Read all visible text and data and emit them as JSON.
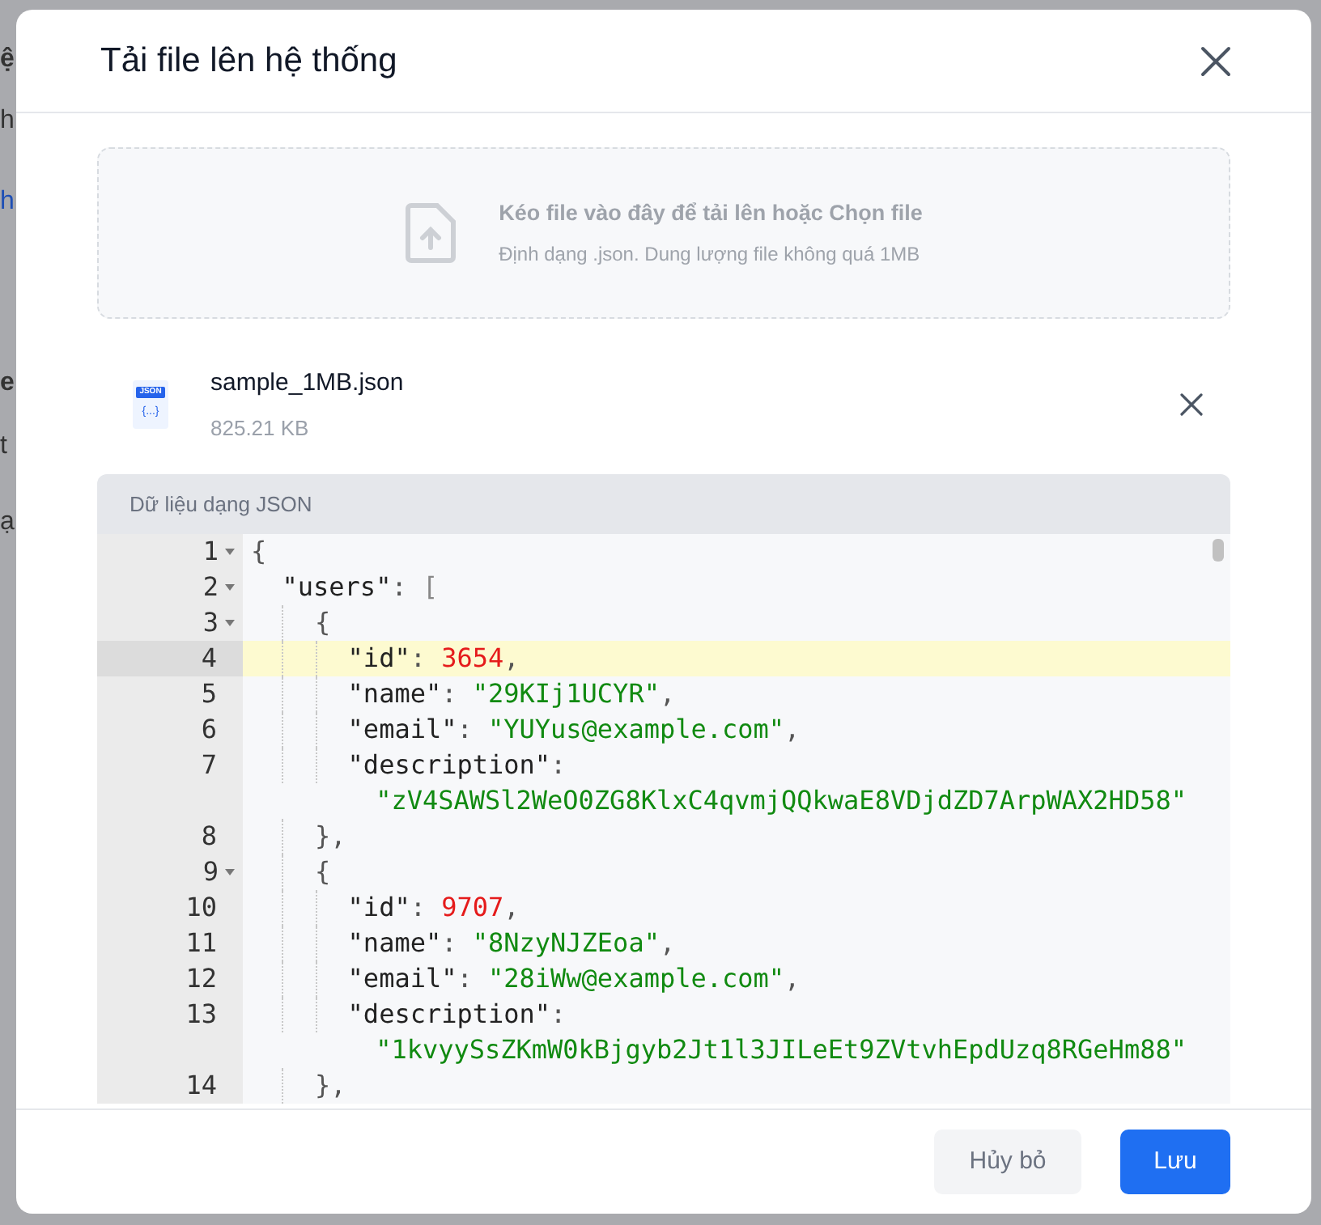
{
  "background": {
    "fragments": [
      {
        "text": "ệ",
        "kind": "heading"
      },
      {
        "text": "h",
        "kind": "text"
      },
      {
        "text": "h",
        "kind": "link"
      },
      {
        "text": "e",
        "kind": "heading"
      },
      {
        "text": "t",
        "kind": "text"
      },
      {
        "text": "ạ",
        "kind": "text"
      }
    ]
  },
  "dialog": {
    "title": "Tải file lên hệ thống",
    "dropzone": {
      "text": "Kéo file vào đây để tải lên hoặc Chọn file",
      "hint": "Định dạng .json. Dung lượng file không quá 1MB"
    },
    "file": {
      "icon_label": "JSON",
      "icon_glyph": "{...}",
      "name": "sample_1MB.json",
      "size": "825.21 KB"
    },
    "editor": {
      "header": "Dữ liệu dạng JSON",
      "lines": [
        {
          "number": "1",
          "foldable": true,
          "active": false,
          "rows": [
            [
              {
                "kind": "punct",
                "text": "{"
              }
            ]
          ]
        },
        {
          "number": "2",
          "foldable": true,
          "active": false,
          "rows": [
            [
              {
                "kind": "indent",
                "text": "  "
              },
              {
                "kind": "key",
                "text": "\"users\""
              },
              {
                "kind": "punct",
                "text": ": "
              },
              {
                "kind": "bracket",
                "text": "["
              }
            ]
          ]
        },
        {
          "number": "3",
          "foldable": true,
          "active": false,
          "rows": [
            [
              {
                "kind": "indent",
                "text": "    "
              },
              {
                "kind": "punct",
                "text": "{"
              }
            ]
          ]
        },
        {
          "number": "4",
          "foldable": false,
          "active": true,
          "rows": [
            [
              {
                "kind": "indent",
                "text": "      "
              },
              {
                "kind": "key",
                "text": "\"id\""
              },
              {
                "kind": "punct",
                "text": ": "
              },
              {
                "kind": "number",
                "text": "3654"
              },
              {
                "kind": "punct",
                "text": ","
              }
            ]
          ]
        },
        {
          "number": "5",
          "foldable": false,
          "active": false,
          "rows": [
            [
              {
                "kind": "indent",
                "text": "      "
              },
              {
                "kind": "key",
                "text": "\"name\""
              },
              {
                "kind": "punct",
                "text": ": "
              },
              {
                "kind": "string",
                "text": "\"29KIj1UCYR\""
              },
              {
                "kind": "punct",
                "text": ","
              }
            ]
          ]
        },
        {
          "number": "6",
          "foldable": false,
          "active": false,
          "rows": [
            [
              {
                "kind": "indent",
                "text": "      "
              },
              {
                "kind": "key",
                "text": "\"email\""
              },
              {
                "kind": "punct",
                "text": ": "
              },
              {
                "kind": "string",
                "text": "\"YUYus@example.com\""
              },
              {
                "kind": "punct",
                "text": ","
              }
            ]
          ]
        },
        {
          "number": "7",
          "foldable": false,
          "active": false,
          "rows": [
            [
              {
                "kind": "indent",
                "text": "      "
              },
              {
                "kind": "key",
                "text": "\"description\""
              },
              {
                "kind": "punct",
                "text": ":"
              }
            ],
            [
              {
                "kind": "indent",
                "text": "        "
              },
              {
                "kind": "string",
                "text": "\"zV4SAWSl2WeO0ZG8KlxC4qvmjQQkwaE8VDjdZD7ArpWAX2HD58\""
              }
            ]
          ]
        },
        {
          "number": "8",
          "foldable": false,
          "active": false,
          "rows": [
            [
              {
                "kind": "indent",
                "text": "    "
              },
              {
                "kind": "punct",
                "text": "},"
              }
            ]
          ]
        },
        {
          "number": "9",
          "foldable": true,
          "active": false,
          "rows": [
            [
              {
                "kind": "indent",
                "text": "    "
              },
              {
                "kind": "punct",
                "text": "{"
              }
            ]
          ]
        },
        {
          "number": "10",
          "foldable": false,
          "active": false,
          "rows": [
            [
              {
                "kind": "indent",
                "text": "      "
              },
              {
                "kind": "key",
                "text": "\"id\""
              },
              {
                "kind": "punct",
                "text": ": "
              },
              {
                "kind": "number",
                "text": "9707"
              },
              {
                "kind": "punct",
                "text": ","
              }
            ]
          ]
        },
        {
          "number": "11",
          "foldable": false,
          "active": false,
          "rows": [
            [
              {
                "kind": "indent",
                "text": "      "
              },
              {
                "kind": "key",
                "text": "\"name\""
              },
              {
                "kind": "punct",
                "text": ": "
              },
              {
                "kind": "string",
                "text": "\"8NzyNJZEoa\""
              },
              {
                "kind": "punct",
                "text": ","
              }
            ]
          ]
        },
        {
          "number": "12",
          "foldable": false,
          "active": false,
          "rows": [
            [
              {
                "kind": "indent",
                "text": "      "
              },
              {
                "kind": "key",
                "text": "\"email\""
              },
              {
                "kind": "punct",
                "text": ": "
              },
              {
                "kind": "string",
                "text": "\"28iWw@example.com\""
              },
              {
                "kind": "punct",
                "text": ","
              }
            ]
          ]
        },
        {
          "number": "13",
          "foldable": false,
          "active": false,
          "rows": [
            [
              {
                "kind": "indent",
                "text": "      "
              },
              {
                "kind": "key",
                "text": "\"description\""
              },
              {
                "kind": "punct",
                "text": ":"
              }
            ],
            [
              {
                "kind": "indent",
                "text": "        "
              },
              {
                "kind": "string",
                "text": "\"1kvyySsZKmW0kBjgyb2Jt1l3JILeEt9ZVtvhEpdUzq8RGeHm88\""
              }
            ]
          ]
        },
        {
          "number": "14",
          "foldable": false,
          "active": false,
          "rows": [
            [
              {
                "kind": "indent",
                "text": "    "
              },
              {
                "kind": "punct",
                "text": "},"
              }
            ]
          ]
        }
      ]
    },
    "buttons": [
      {
        "label": "Hủy bỏ",
        "kind": "secondary"
      },
      {
        "label": "Lưu",
        "kind": "primary"
      }
    ]
  }
}
